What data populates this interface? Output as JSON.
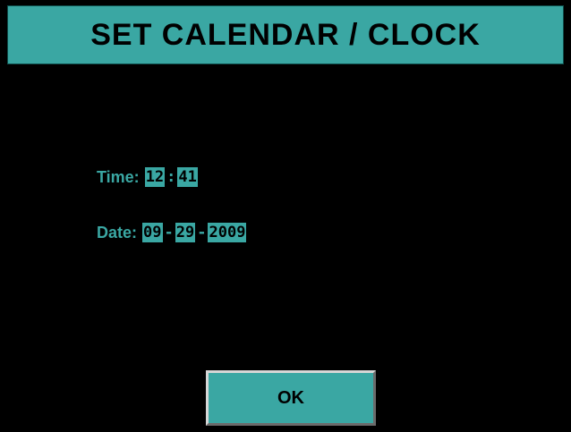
{
  "header": {
    "title": "SET CALENDAR / CLOCK"
  },
  "time": {
    "label": "Time:",
    "hour": "12",
    "separator": ":",
    "minute": "41"
  },
  "date": {
    "label": "Date:",
    "month": "09",
    "separator": "-",
    "day": "29",
    "year": "2009"
  },
  "actions": {
    "ok_label": "OK"
  },
  "colors": {
    "accent": "#3aa7a3",
    "background": "#000000",
    "text_on_accent": "#000000"
  }
}
